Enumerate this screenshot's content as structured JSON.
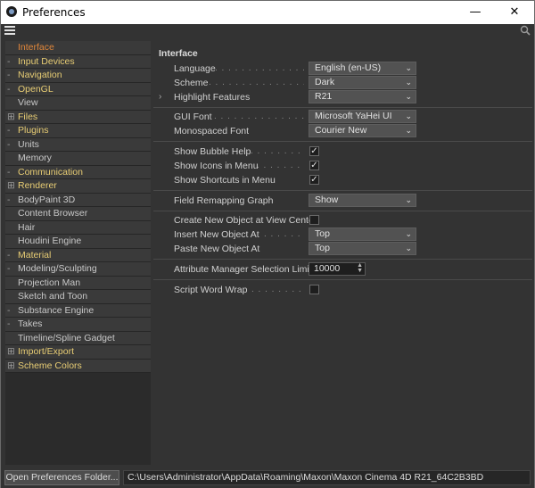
{
  "window": {
    "title": "Preferences",
    "minimize_glyph": "—",
    "maximize_glyph": "☐",
    "close_glyph": "✕"
  },
  "sidebar": {
    "items": [
      {
        "label": "Interface",
        "prefix": "",
        "level": "top",
        "active": true
      },
      {
        "label": "Input Devices",
        "prefix": "-",
        "level": "top"
      },
      {
        "label": "Navigation",
        "prefix": "-",
        "level": "top"
      },
      {
        "label": "OpenGL",
        "prefix": "-",
        "level": "top"
      },
      {
        "label": "View",
        "prefix": "",
        "level": "child"
      },
      {
        "label": "Files",
        "prefix": "⊞",
        "level": "top"
      },
      {
        "label": "Plugins",
        "prefix": "-",
        "level": "top"
      },
      {
        "label": "Units",
        "prefix": "-",
        "level": "child"
      },
      {
        "label": "Memory",
        "prefix": "",
        "level": "child"
      },
      {
        "label": "Communication",
        "prefix": "-",
        "level": "top"
      },
      {
        "label": "Renderer",
        "prefix": "⊞",
        "level": "top"
      },
      {
        "label": "BodyPaint 3D",
        "prefix": "-",
        "level": "child"
      },
      {
        "label": "Content Browser",
        "prefix": "",
        "level": "child"
      },
      {
        "label": "Hair",
        "prefix": "",
        "level": "child"
      },
      {
        "label": "Houdini Engine",
        "prefix": "",
        "level": "child"
      },
      {
        "label": "Material",
        "prefix": "-",
        "level": "top"
      },
      {
        "label": "Modeling/Sculpting",
        "prefix": "-",
        "level": "child"
      },
      {
        "label": "Projection Man",
        "prefix": "",
        "level": "child"
      },
      {
        "label": "Sketch and Toon",
        "prefix": "",
        "level": "child"
      },
      {
        "label": "Substance Engine",
        "prefix": "-",
        "level": "child"
      },
      {
        "label": "Takes",
        "prefix": "-",
        "level": "child"
      },
      {
        "label": "Timeline/Spline Gadget",
        "prefix": "",
        "level": "child"
      },
      {
        "label": "Import/Export",
        "prefix": "⊞",
        "level": "top"
      },
      {
        "label": "Scheme Colors",
        "prefix": "⊞",
        "level": "top"
      }
    ]
  },
  "content": {
    "section_title": "Interface",
    "language": {
      "label": "Language",
      "value": "English (en-US)"
    },
    "scheme": {
      "label": "Scheme",
      "value": "Dark"
    },
    "highlight": {
      "label": "Highlight Features",
      "value": "R21"
    },
    "gui_font": {
      "label": "GUI Font",
      "value": "Microsoft YaHei UI"
    },
    "mono_font": {
      "label": "Monospaced Font",
      "value": "Courier New"
    },
    "bubble_help": {
      "label": "Show Bubble Help",
      "checked": true
    },
    "icons_menu": {
      "label": "Show Icons in Menu",
      "checked": true
    },
    "shortcuts_menu": {
      "label": "Show Shortcuts in Menu",
      "checked": true
    },
    "field_remap": {
      "label": "Field Remapping Graph",
      "value": "Show"
    },
    "create_at_center": {
      "label": "Create New Object at View Center",
      "checked": false
    },
    "insert_at": {
      "label": "Insert New Object At",
      "value": "Top"
    },
    "paste_at": {
      "label": "Paste New Object At",
      "value": "Top"
    },
    "attr_limit": {
      "label": "Attribute Manager Selection Limit",
      "value": "10000"
    },
    "script_wrap": {
      "label": "Script Word Wrap",
      "checked": false
    }
  },
  "footer": {
    "open_button": "Open Preferences Folder...",
    "path": "C:\\Users\\Administrator\\AppData\\Roaming\\Maxon\\Maxon Cinema 4D R21_64C2B3BD"
  },
  "icons": {
    "menu": "hamburger-icon",
    "search": "search-icon",
    "dropdown": "chevron-down-icon",
    "check": "checkmark-icon"
  },
  "colors": {
    "background": "#333333",
    "active_item": "#e0873a",
    "category_item": "#e8cd74"
  }
}
